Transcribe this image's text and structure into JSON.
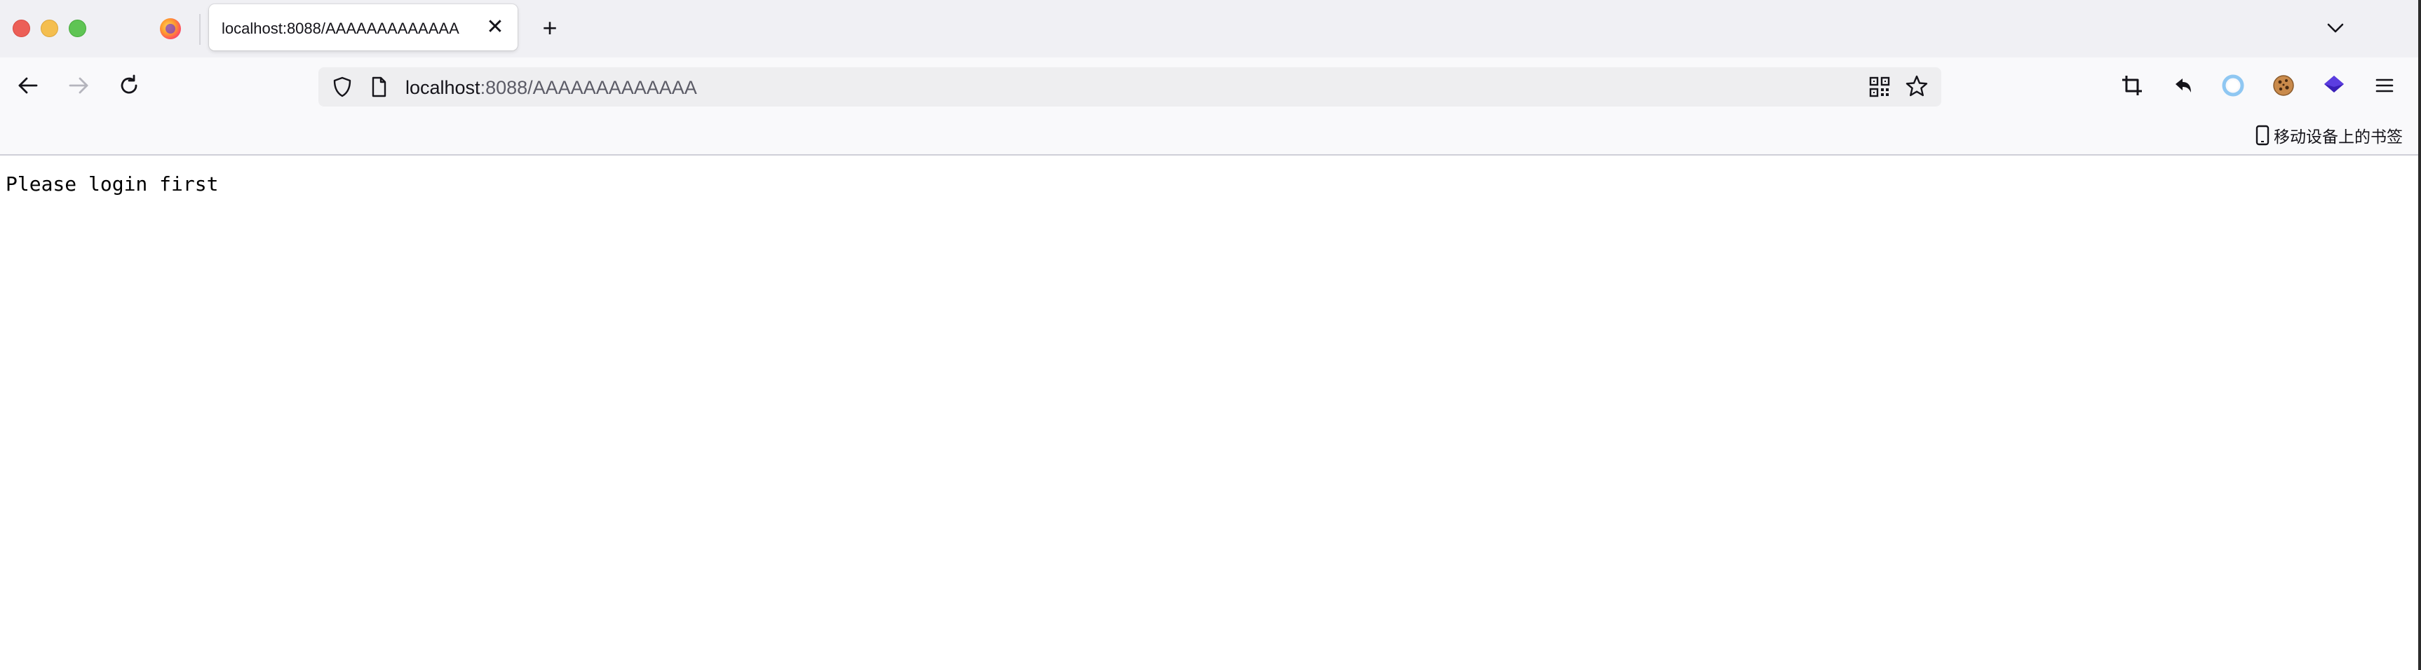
{
  "browser": {
    "window_controls": [
      "close",
      "minimize",
      "maximize"
    ],
    "tab": {
      "title": "localhost:8088/AAAAAAAAAAAAA",
      "close_symbol": "✕"
    },
    "new_tab_symbol": "+",
    "url": {
      "host": "localhost",
      "rest": ":8088/AAAAAAAAAAAAA"
    },
    "bookmarks": {
      "mobile_label": "移动设备上的书签"
    },
    "icons": {
      "back": "arrow-left-icon",
      "forward": "arrow-right-icon",
      "reload": "reload-icon",
      "tracking_protection": "shield-icon",
      "page_info": "page-icon",
      "qr_code": "qr-code-icon",
      "bookmark_star": "star-icon",
      "screenshot": "crop-icon",
      "undo": "undo-icon",
      "extension_ring": "ring-icon",
      "cookie": "cookie-icon",
      "layers": "layers-icon",
      "menu": "hamburger-menu-icon",
      "tab_list": "chevron-down-icon"
    },
    "colors": {
      "tabstrip_bg": "#f0f0f4",
      "toolbar_bg": "#f9f9fb",
      "urlbar_bg": "#eeeef0",
      "traffic_close": "#ec5f57",
      "traffic_min": "#f4be4f",
      "traffic_max": "#5fc454"
    }
  },
  "page": {
    "message": "Please login first"
  }
}
